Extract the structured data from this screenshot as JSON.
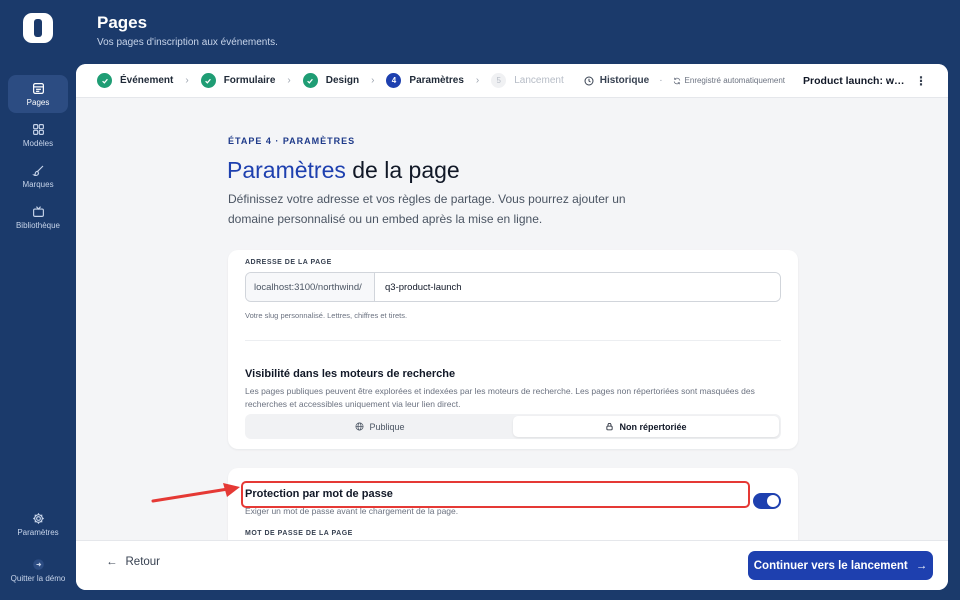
{
  "sidebar": {
    "items": [
      {
        "label": "Pages",
        "icon": "pages-icon"
      },
      {
        "label": "Modèles",
        "icon": "grid-icon"
      },
      {
        "label": "Marques",
        "icon": "brush-icon"
      },
      {
        "label": "Bibliothèque",
        "icon": "tv-icon"
      }
    ],
    "bottom": [
      {
        "label": "Paramètres",
        "icon": "gear-icon"
      },
      {
        "label": "Quitter la démo",
        "icon": "exit-icon"
      }
    ]
  },
  "header": {
    "title": "Pages",
    "subtitle": "Vos pages d'inscription aux événements."
  },
  "stepper": {
    "steps": [
      {
        "num": "1",
        "label": "Événement",
        "state": "done"
      },
      {
        "num": "2",
        "label": "Formulaire",
        "state": "done"
      },
      {
        "num": "3",
        "label": "Design",
        "state": "done"
      },
      {
        "num": "4",
        "label": "Paramètres",
        "state": "current"
      },
      {
        "num": "5",
        "label": "Lancement",
        "state": "disabled"
      }
    ],
    "history_label": "Historique",
    "autosave_label": "Enregistré automatiquement",
    "doc_title": "Product launch: wha..."
  },
  "main": {
    "eyebrow": "ÉTAPE 4 · PARAMÈTRES",
    "title_accent": "Paramètres",
    "title_rest": " de la page",
    "description": "Définissez votre adresse et vos règles de partage. Vous pourrez ajouter un domaine personnalisé ou un embed après la mise en ligne."
  },
  "address": {
    "label": "ADRESSE DE LA PAGE",
    "prefix": "localhost:3100/northwind/",
    "slug": "q3-product-launch",
    "hint": "Votre slug personnalisé. Lettres, chiffres et tirets."
  },
  "visibility": {
    "title": "Visibilité dans les moteurs de recherche",
    "description": "Les pages publiques peuvent être explorées et indexées par les moteurs de recherche. Les pages non répertoriées sont masquées des recherches et accessibles uniquement via leur lien direct.",
    "options": [
      "Publique",
      "Non répertoriée"
    ],
    "selected": "Non répertoriée"
  },
  "password": {
    "title": "Protection par mot de passe",
    "description": "Exiger un mot de passe avant le chargement de la page.",
    "enabled": true,
    "field_label": "MOT DE PASSE DE LA PAGE"
  },
  "footer": {
    "back_label": "Retour",
    "next_label": "Continuer vers le lancement"
  },
  "colors": {
    "brand": "#1b3a6b",
    "accent": "#1e40af",
    "success": "#1f9d74",
    "annotation": "#e53935"
  }
}
